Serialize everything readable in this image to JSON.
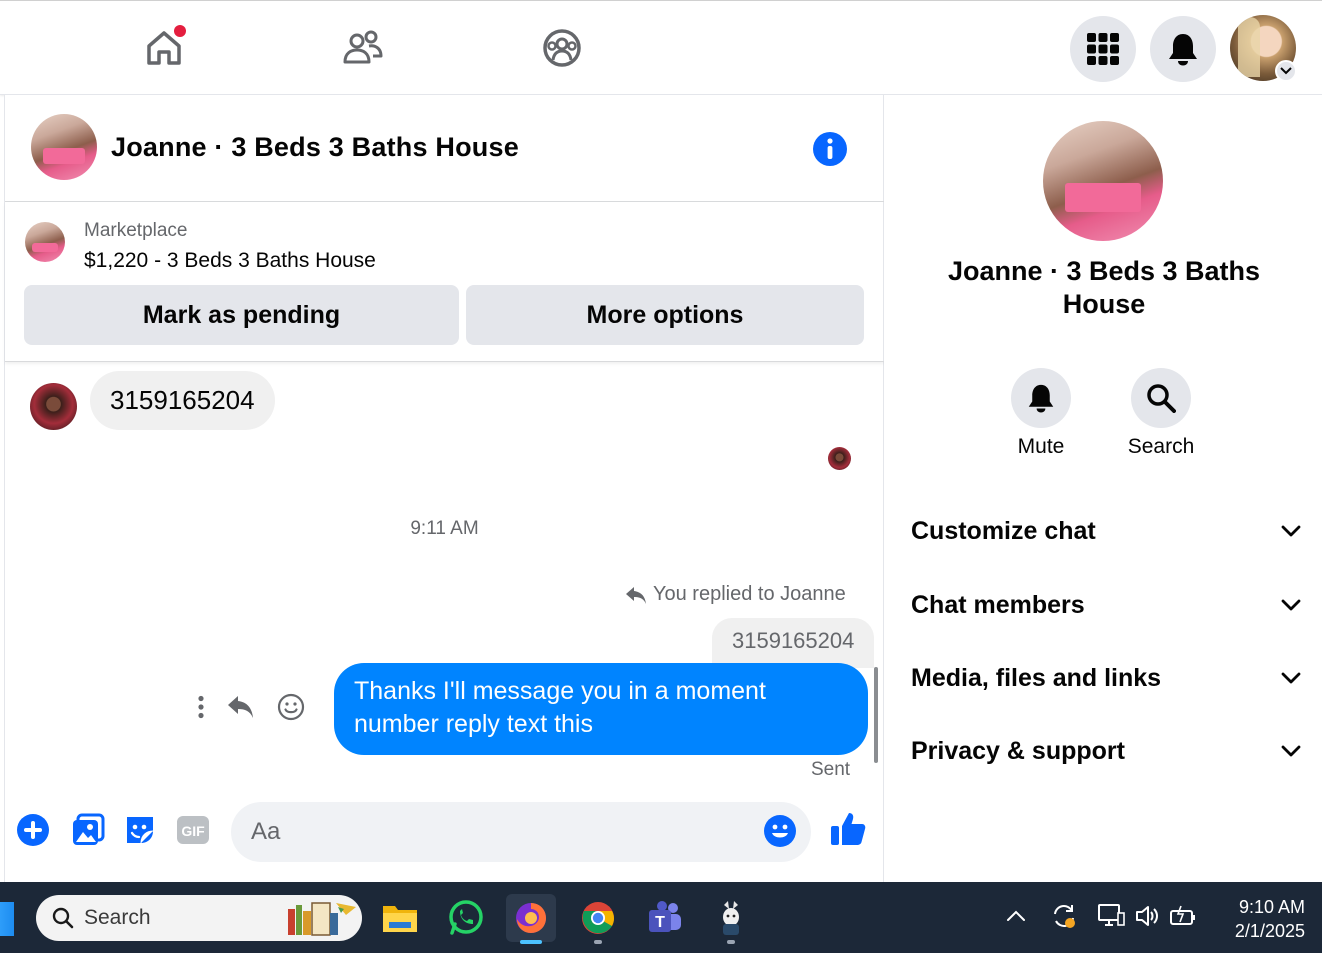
{
  "nav": {
    "items": [
      "home-icon",
      "friends-icon",
      "groups-icon"
    ],
    "home_notification": true,
    "right": [
      "menu-grid-icon",
      "bell-icon",
      "profile-avatar"
    ]
  },
  "chat": {
    "title": "Joanne · 3 Beds 3 Baths House",
    "marketplace": {
      "label": "Marketplace",
      "item": "$1,220 - 3 Beds 3 Baths House",
      "btn_pending": "Mark as pending",
      "btn_more": "More options"
    },
    "messages": {
      "incoming_text": "3159165204",
      "timestamp": "9:11 AM",
      "replied_note": "You replied to Joanne",
      "quoted_text": "3159165204",
      "outgoing_line1": "Thanks I'll message you in a moment",
      "outgoing_line2": "number reply text this",
      "status": "Sent"
    },
    "composer": {
      "placeholder": "Aa"
    }
  },
  "side": {
    "title_line1": "Joanne · 3 Beds 3 Baths",
    "title_line2": "House",
    "mute_label": "Mute",
    "search_label": "Search",
    "sections": [
      "Customize chat",
      "Chat members",
      "Media, files and links",
      "Privacy & support"
    ]
  },
  "taskbar": {
    "search_placeholder": "Search",
    "time": "9:10 AM",
    "date": "2/1/2025"
  },
  "colors": {
    "messenger_blue": "#0084ff",
    "facebook_blue": "#0866ff",
    "notification_red": "#e41e3f",
    "taskbar_bg": "#1c2838"
  }
}
